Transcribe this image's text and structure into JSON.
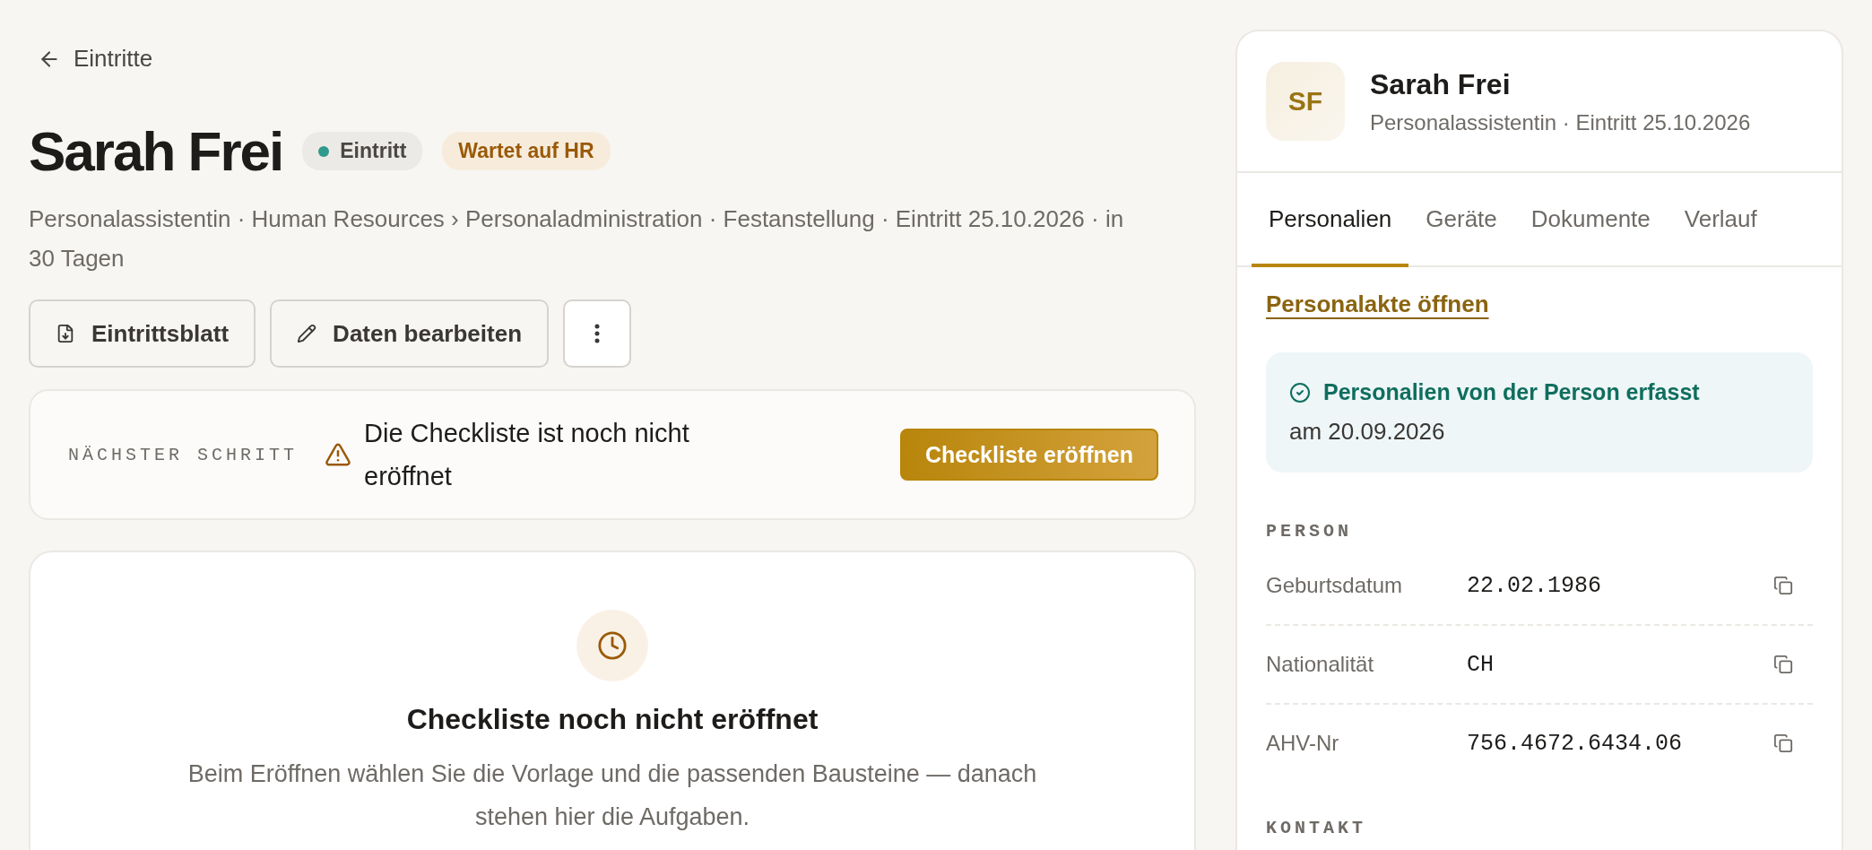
{
  "back_link": {
    "label": "Eintritte"
  },
  "header": {
    "title": "Sarah Frei",
    "badges": [
      {
        "kind": "status",
        "label": "Eintritt",
        "color": "#2f9a8c"
      },
      {
        "kind": "warning",
        "label": "Wartet auf HR"
      }
    ],
    "subtitle": "Personalassistentin · Human Resources › Personaladministration · Festanstellung · Eintritt 25.10.2026 · in 30 Tagen"
  },
  "actions": [
    {
      "kind": "download",
      "label": "Eintrittsblatt"
    },
    {
      "kind": "edit",
      "label": "Daten bearbeiten"
    },
    {
      "kind": "more"
    }
  ],
  "next_step": {
    "label": "NÄCHSTER SCHRITT",
    "message": "Die Checkliste ist noch nicht eröffnet",
    "button": "Checkliste eröffnen"
  },
  "empty_state": {
    "title": "Checkliste noch nicht eröffnet",
    "text": "Beim Eröffnen wählen Sie die Vorlage und die passenden Bausteine — danach stehen hier die Aufgaben."
  },
  "profile": {
    "initials": "SF",
    "name": "Sarah Frei",
    "subtitle": "Personalassistentin · Eintritt 25.10.2026",
    "tabs": [
      {
        "label": "Personalien",
        "selected": true
      },
      {
        "label": "Geräte",
        "selected": false
      },
      {
        "label": "Dokumente",
        "selected": false
      },
      {
        "label": "Verlauf",
        "selected": false
      }
    ],
    "link": "Personalakte öffnen",
    "notice": {
      "title": "Personalien von der Person erfasst",
      "text": "am 20.09.2026"
    },
    "sections": [
      {
        "title": "PERSON",
        "fields": [
          {
            "label": "Geburtsdatum",
            "value": "22.02.1986"
          },
          {
            "label": "Nationalität",
            "value": "CH"
          },
          {
            "label": "AHV-Nr",
            "value": "756.4672.6434.06"
          }
        ]
      },
      {
        "title": "KONTAKT"
      }
    ]
  }
}
